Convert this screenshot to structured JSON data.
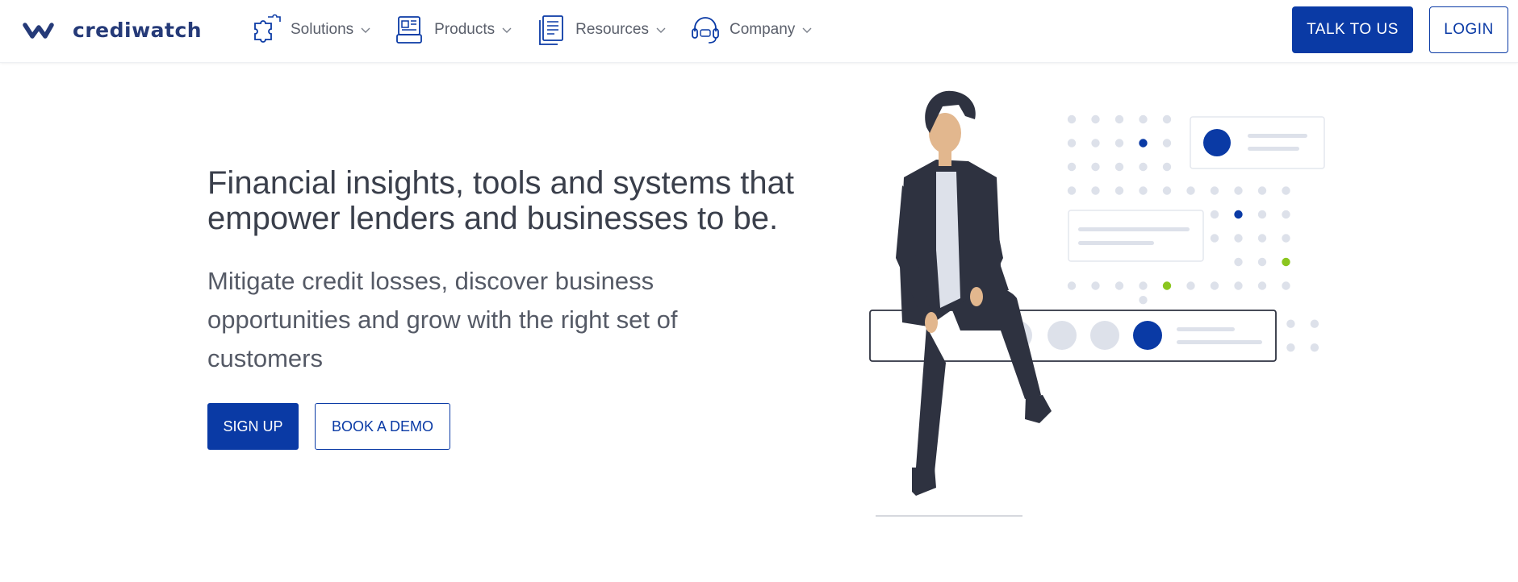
{
  "brand": {
    "name": "crediwatch",
    "color": "#253a78"
  },
  "nav": {
    "items": [
      {
        "label": "Solutions",
        "icon": "puzzle-icon"
      },
      {
        "label": "Products",
        "icon": "products-icon"
      },
      {
        "label": "Resources",
        "icon": "document-icon"
      },
      {
        "label": "Company",
        "icon": "headset-icon"
      }
    ],
    "talk_label": "TALK TO US",
    "login_label": "LOGIN"
  },
  "hero": {
    "title": "Financial insights, tools and systems that empower lenders and businesses to be.",
    "subtitle": "Mitigate credit losses, discover business opportunities and grow with the right set of customers",
    "signup_label": "SIGN UP",
    "demo_label": "BOOK A DEMO"
  },
  "colors": {
    "primary": "#0a3aa5",
    "accent_green": "#8bc61f",
    "muted_gray": "#dde1ea",
    "figure_dark": "#2e3240",
    "skin": "#e2b78e"
  }
}
